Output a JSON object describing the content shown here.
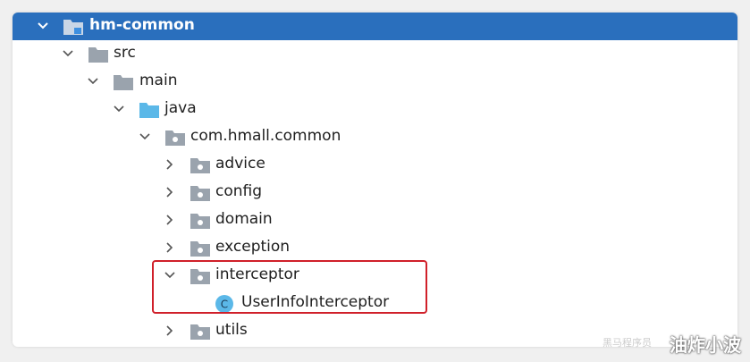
{
  "tree": {
    "root": {
      "label": "hm-common",
      "expanded": true,
      "icon": "module-folder-icon"
    },
    "src": {
      "label": "src",
      "expanded": true,
      "icon": "folder-icon"
    },
    "main": {
      "label": "main",
      "expanded": true,
      "icon": "folder-icon"
    },
    "java": {
      "label": "java",
      "expanded": true,
      "icon": "source-folder-icon"
    },
    "package": {
      "label": "com.hmall.common",
      "expanded": true,
      "icon": "package-icon"
    },
    "advice": {
      "label": "advice",
      "expanded": false,
      "icon": "package-icon"
    },
    "config": {
      "label": "config",
      "expanded": false,
      "icon": "package-icon"
    },
    "domain": {
      "label": "domain",
      "expanded": false,
      "icon": "package-icon"
    },
    "exception": {
      "label": "exception",
      "expanded": false,
      "icon": "package-icon"
    },
    "interceptor": {
      "label": "interceptor",
      "expanded": true,
      "icon": "package-icon"
    },
    "userinfo": {
      "label": "UserInfoInterceptor",
      "icon": "class-icon",
      "icon_letter": "C"
    },
    "utils": {
      "label": "utils",
      "expanded": false,
      "icon": "package-icon"
    }
  },
  "colors": {
    "selection": "#2a6fbd",
    "folder": "#9aa3ad",
    "source_folder": "#5bb8e8",
    "class_icon": "#5bb8e8",
    "highlight_border": "#d0202a"
  },
  "watermark": {
    "text": "油炸小波",
    "small_text": "黑马程序员"
  }
}
